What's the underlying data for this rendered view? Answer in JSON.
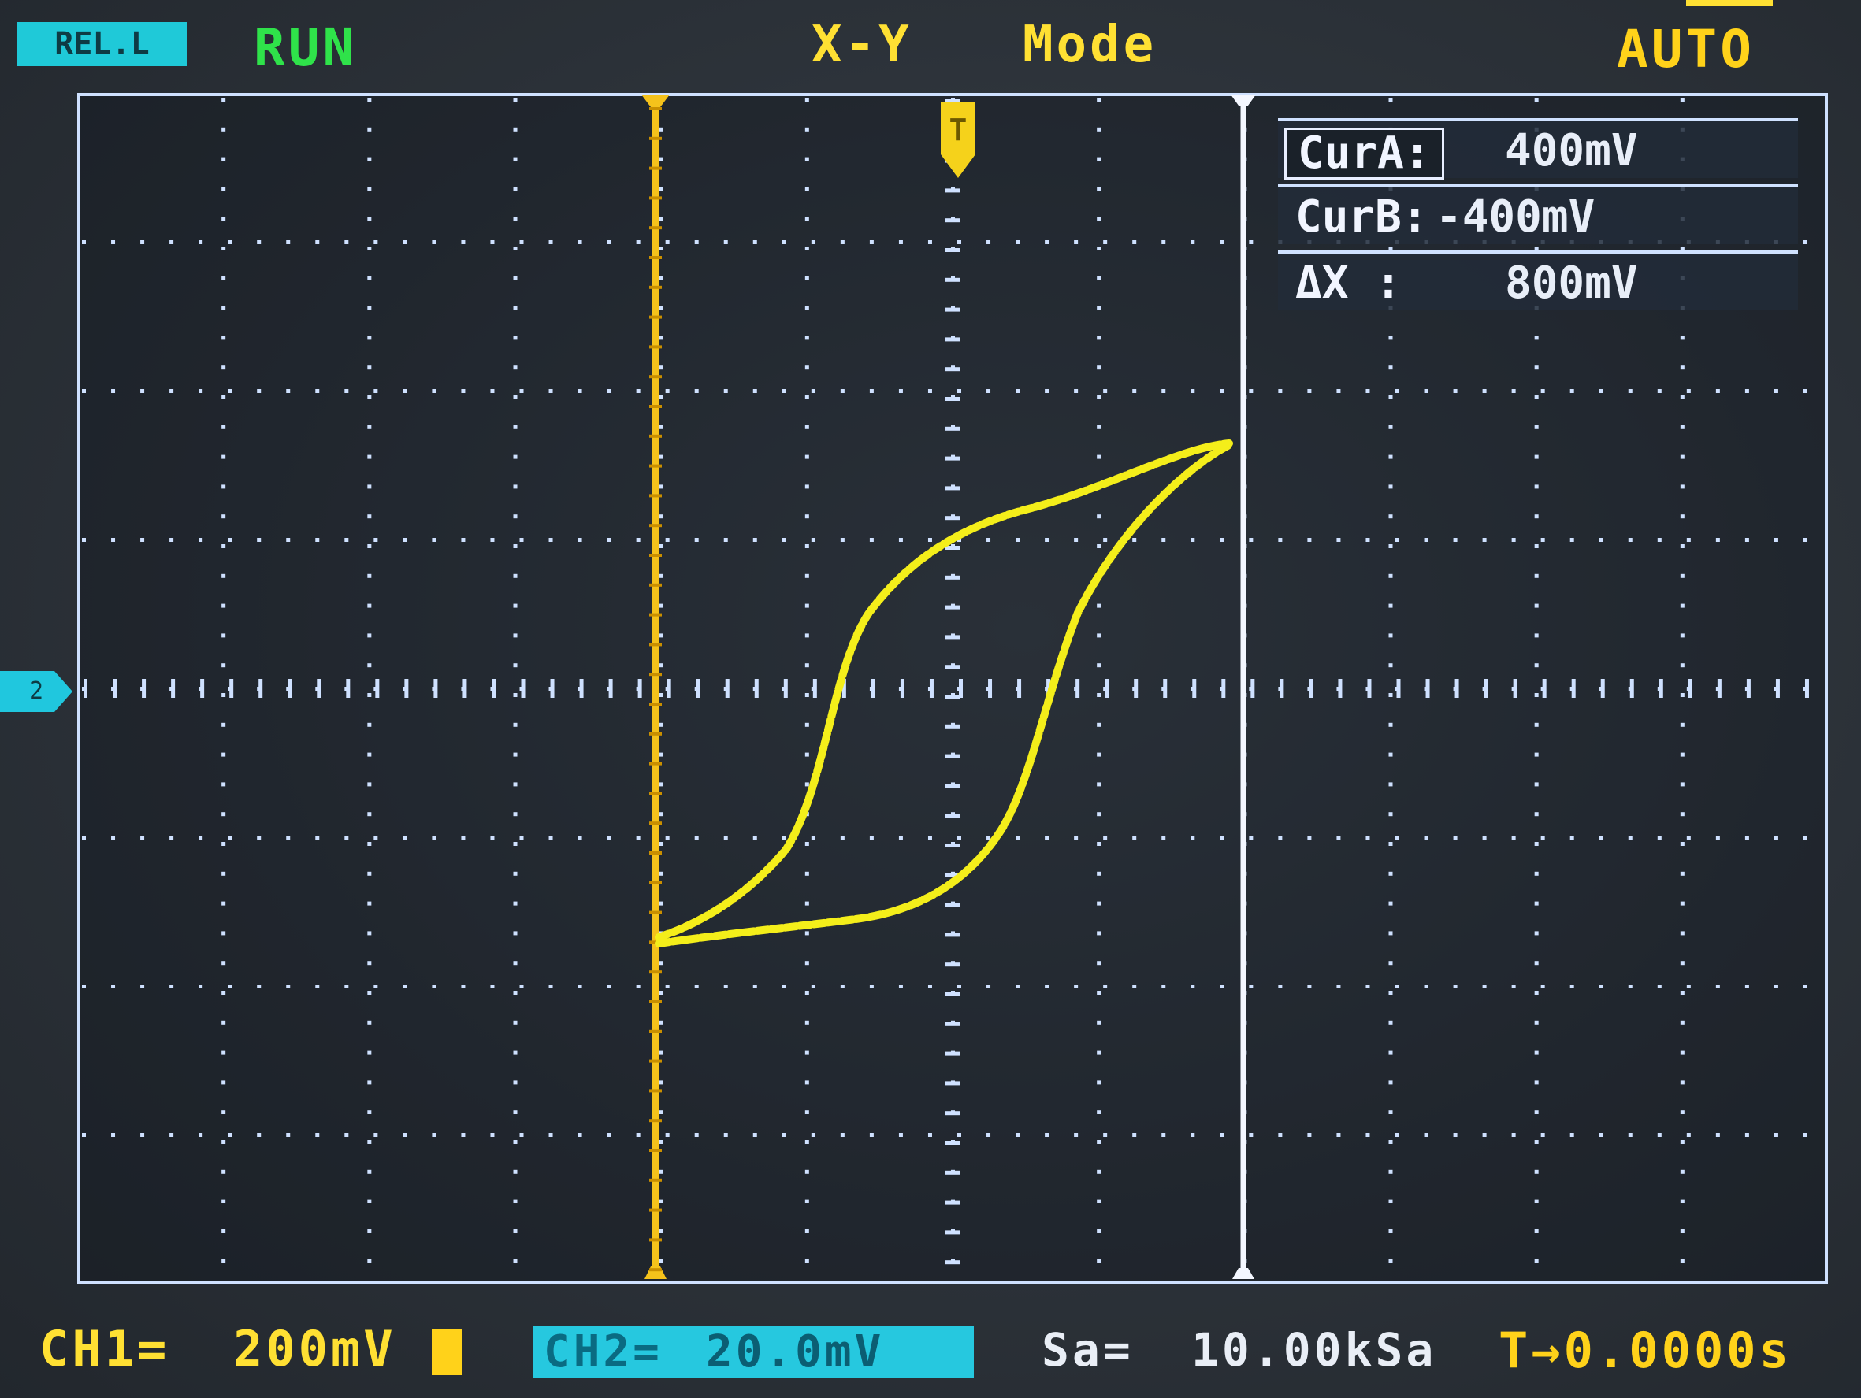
{
  "header": {
    "menu_badge": "REL.L",
    "run_status": "RUN",
    "mode_prefix": "X-Y",
    "mode_label": "Mode",
    "trigger_mode": "AUTO"
  },
  "markers": {
    "ref_marker": "2",
    "trigger_marker": "T"
  },
  "cursor_panel": {
    "rows": [
      {
        "label": "CurA:",
        "value": "400mV"
      },
      {
        "label": "CurB:",
        "value": "-400mV"
      },
      {
        "label": "ΔX  :",
        "value": "800mV"
      }
    ]
  },
  "footer": {
    "ch1_label": "CH1=",
    "ch1_scale": "200mV",
    "ch2_label": "CH2=",
    "ch2_scale": "20.0mV",
    "sample_rate_label": "Sa=",
    "sample_rate_value": "10.00kSa",
    "trigger_offset": "T→0.0000s"
  },
  "colors": {
    "trace": "#f4ee1a",
    "cursor_a": "#f5c21b",
    "cursor_b": "#ffffff",
    "grid_dots": "#cfe1ff",
    "ch2_accent": "#26c8df"
  }
}
